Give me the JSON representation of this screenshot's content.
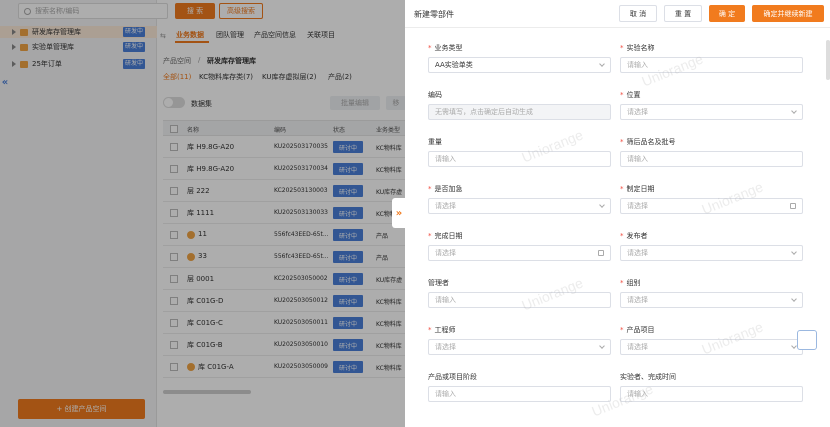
{
  "search": {
    "placeholder": "搜索名称/编码",
    "search_btn": "搜 索",
    "advanced_btn": "高级搜索"
  },
  "tree": [
    {
      "label": "研发库存管理库",
      "badge": "研发中",
      "selected": true
    },
    {
      "label": "实验单管理库",
      "badge": "研发中",
      "selected": false
    },
    {
      "label": "25年订单",
      "badge": "研发中",
      "selected": false
    }
  ],
  "sidebar": {
    "new_space_btn": "+ 创建产品空间"
  },
  "tabs": [
    "业务数据",
    "团队管理",
    "产品空间信息",
    "关联项目"
  ],
  "breadcrumb": {
    "root": "产品空间",
    "sep": "/",
    "current": "研发库存管理库"
  },
  "subtabs": [
    "全部(11)",
    "KC物料库存类(7)",
    "KU库存虚拟层(2)",
    "产品(2)"
  ],
  "toolbar": {
    "dataset_label": "数据集",
    "batch_edit": "批量编辑",
    "more": "移"
  },
  "table": {
    "headers": [
      "名称",
      "编码",
      "状态",
      "业务类型"
    ],
    "rows": [
      {
        "name": "库 H9.8G-A20",
        "code": "KU202503170035",
        "status": "研讨中",
        "type": "KC物料库"
      },
      {
        "name": "库 H9.8G-A20",
        "code": "KU202503170034",
        "status": "研讨中",
        "type": "KC物料库"
      },
      {
        "name": "层 222",
        "code": "KC202503130003",
        "status": "研讨中",
        "type": "KU库存虚"
      },
      {
        "name": "库 1111",
        "code": "KU202503130033",
        "status": "研讨中",
        "type": "KC物料库"
      },
      {
        "name": "11",
        "code": "556fc43EED-65t...",
        "status": "研讨中",
        "type": "产品",
        "warn": true
      },
      {
        "name": "33",
        "code": "556fc43EED-65t...",
        "status": "研讨中",
        "type": "产品",
        "warn": true
      },
      {
        "name": "层 0001",
        "code": "KC202503050002",
        "status": "研讨中",
        "type": "KU库存虚"
      },
      {
        "name": "库 C01G-D",
        "code": "KU202503050012",
        "status": "研讨中",
        "type": "KC物料库"
      },
      {
        "name": "库 C01G-C",
        "code": "KU202503050011",
        "status": "研讨中",
        "type": "KC物料库"
      },
      {
        "name": "库 C01G-B",
        "code": "KU202503050010",
        "status": "研讨中",
        "type": "KC物料库"
      },
      {
        "name": "库 C01G-A",
        "code": "KU202503050009",
        "status": "研讨中",
        "type": "KC物料库",
        "warn": true
      }
    ]
  },
  "drawer": {
    "title": "新建零部件",
    "cancel": "取 消",
    "reset": "重 置",
    "confirm": "确 定",
    "confirm_continue": "确定并继续新建",
    "fields": [
      {
        "label": "业务类型",
        "required": true,
        "value": "AA实验单类",
        "kind": "select"
      },
      {
        "label": "实验名称",
        "required": true,
        "placeholder": "请输入",
        "kind": "input"
      },
      {
        "label": "编码",
        "required": false,
        "placeholder": "无需填写，点击确定后自动生成",
        "kind": "disabled"
      },
      {
        "label": "位置",
        "required": true,
        "placeholder": "请选择",
        "kind": "select"
      },
      {
        "label": "重量",
        "required": false,
        "placeholder": "请输入",
        "kind": "input"
      },
      {
        "label": "筛后品名及批号",
        "required": true,
        "placeholder": "请输入",
        "kind": "input"
      },
      {
        "label": "是否加急",
        "required": true,
        "placeholder": "请选择",
        "kind": "select"
      },
      {
        "label": "制定日期",
        "required": true,
        "placeholder": "请选择",
        "kind": "date"
      },
      {
        "label": "完成日期",
        "required": true,
        "placeholder": "请选择",
        "kind": "date"
      },
      {
        "label": "发布者",
        "required": true,
        "placeholder": "请选择",
        "kind": "select"
      },
      {
        "label": "管理者",
        "required": false,
        "placeholder": "请输入",
        "kind": "input"
      },
      {
        "label": "组别",
        "required": true,
        "placeholder": "请选择",
        "kind": "select"
      },
      {
        "label": "工程师",
        "required": true,
        "placeholder": "请选择",
        "kind": "select"
      },
      {
        "label": "产品项目",
        "required": true,
        "placeholder": "请选择",
        "kind": "select"
      },
      {
        "label": "产品或项目阶段",
        "required": false,
        "placeholder": "请输入",
        "kind": "input"
      },
      {
        "label": "实验者、完成时间",
        "required": false,
        "placeholder": "请输入",
        "kind": "input"
      }
    ]
  },
  "watermark": "Uniorange",
  "colors": {
    "accent": "#f17b1e",
    "status_blue": "#4a7fd9",
    "required_red": "#f04b3e"
  }
}
